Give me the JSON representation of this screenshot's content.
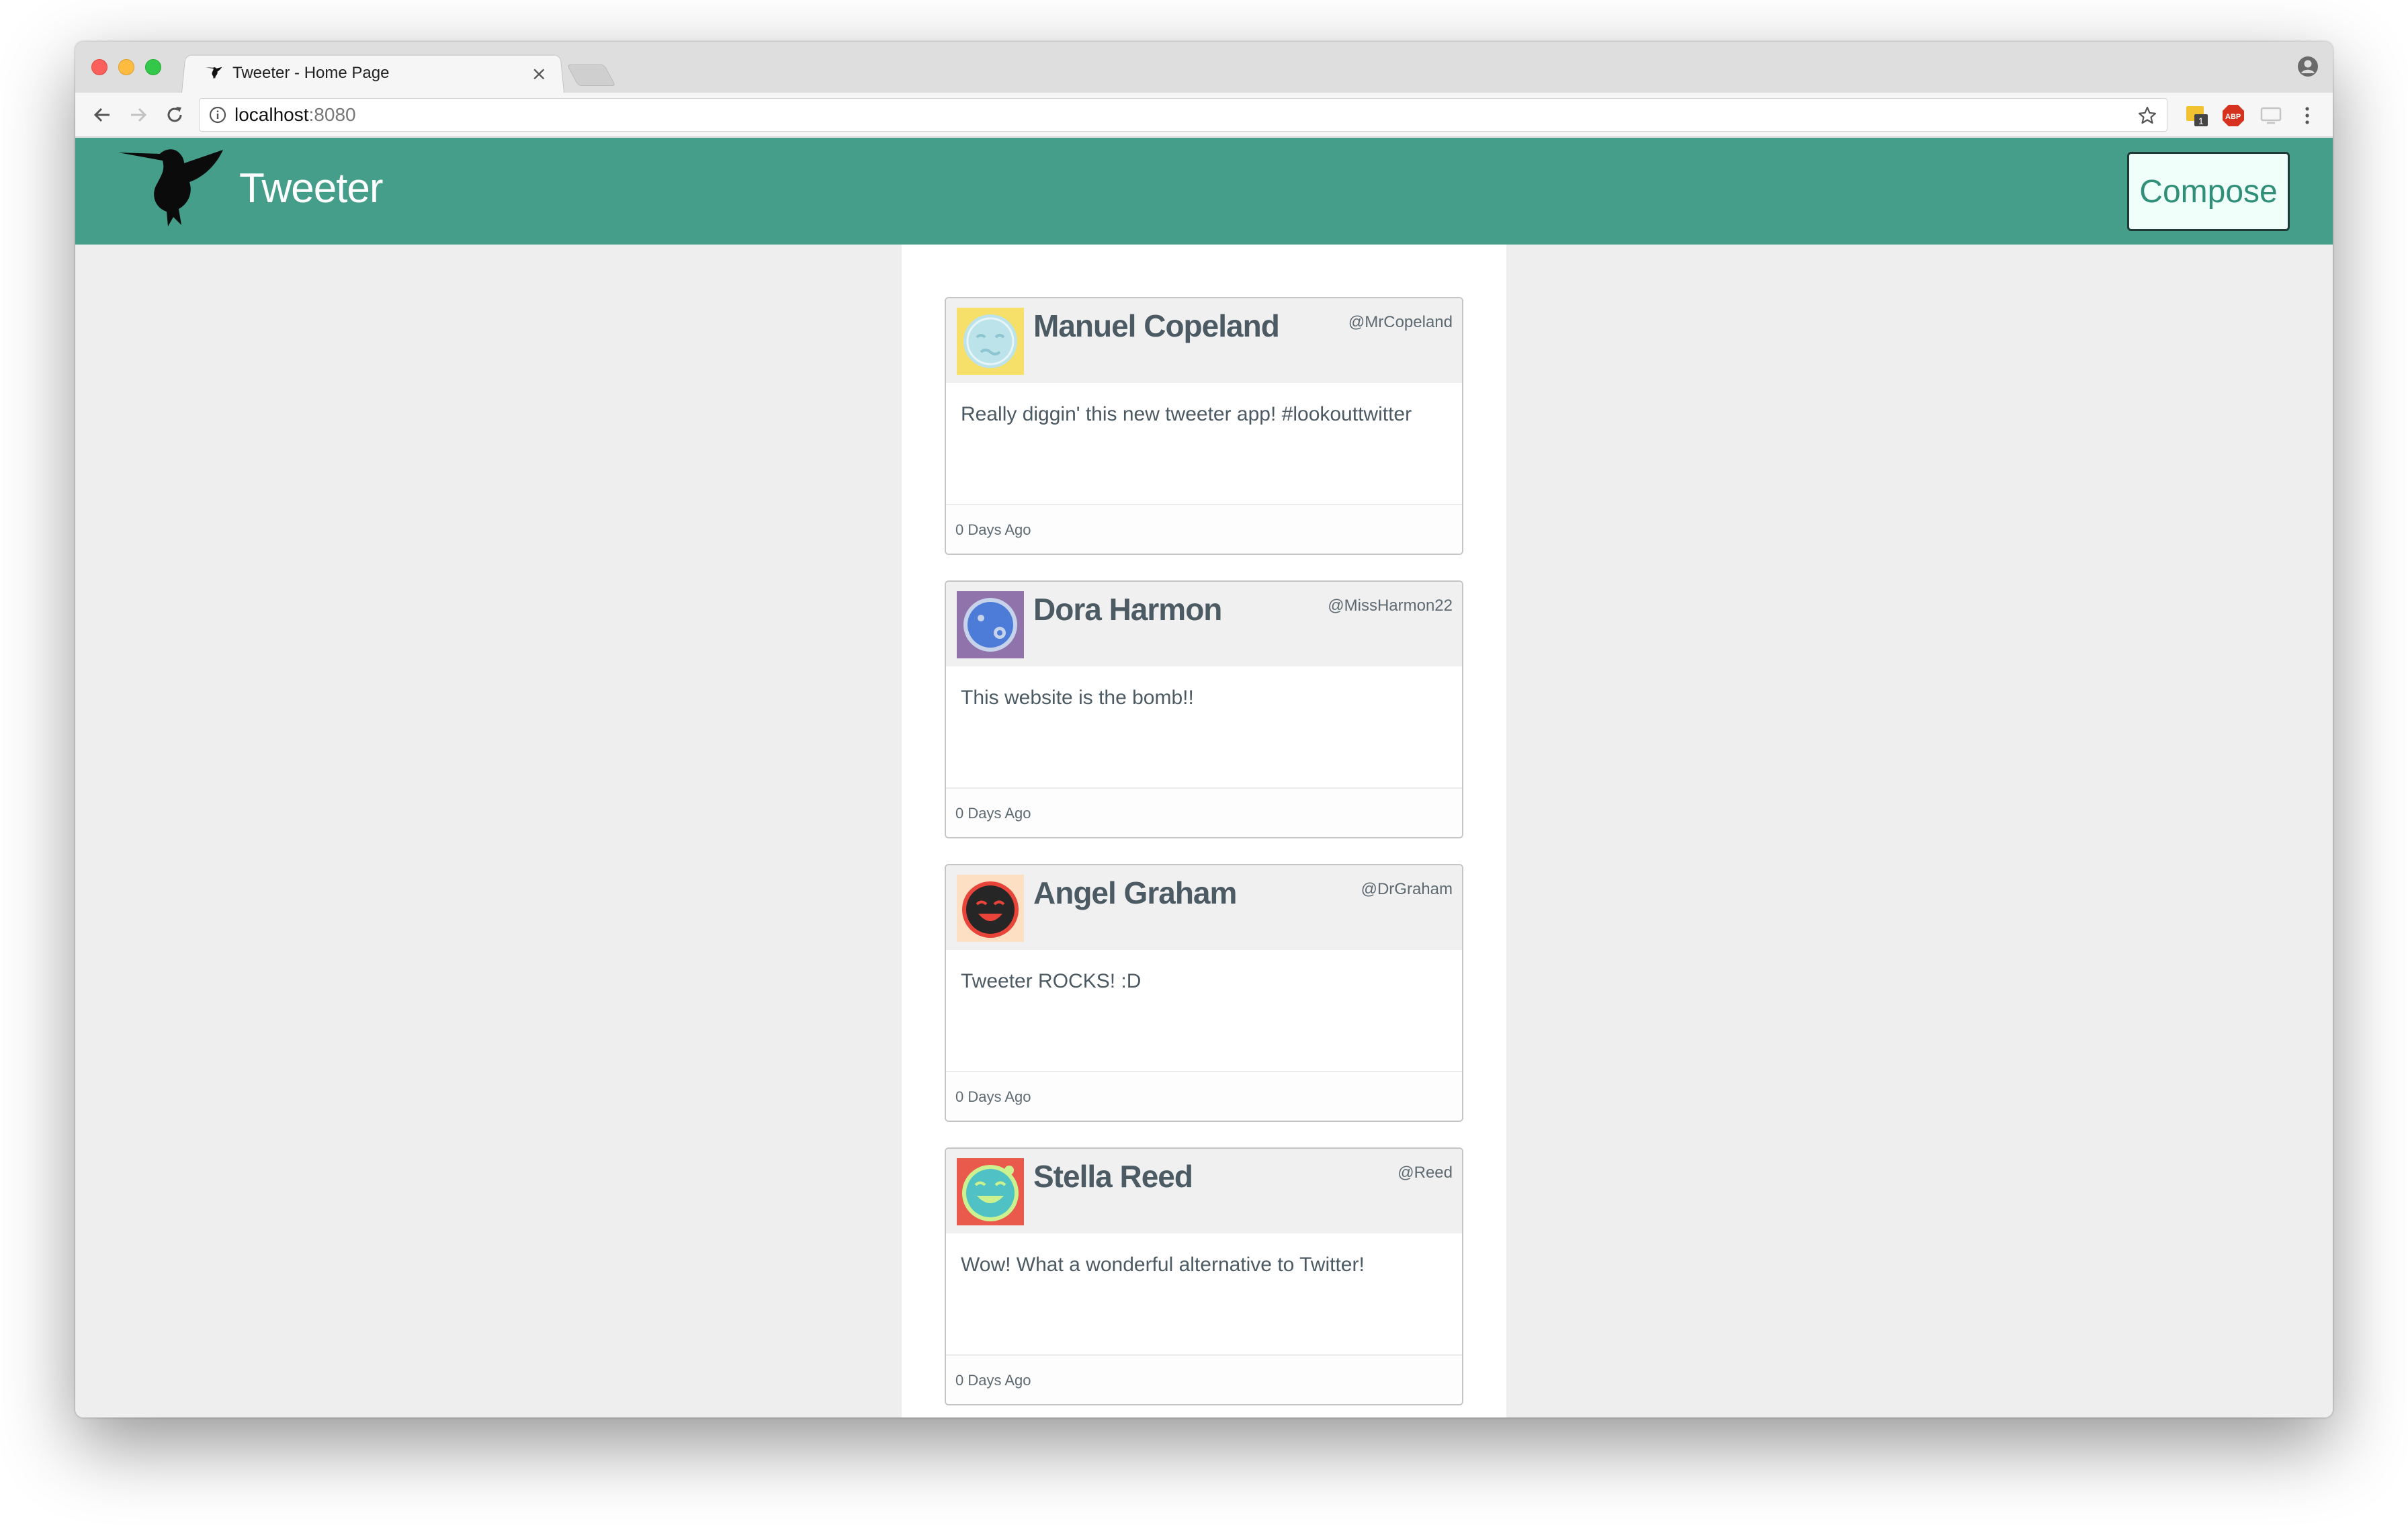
{
  "browser": {
    "tab_title": "Tweeter - Home Page",
    "tab_close": "×",
    "url_host": "localhost",
    "url_port": ":8080",
    "extension_badge": "1",
    "adblock_label": "ABP"
  },
  "header": {
    "brand": "Tweeter",
    "compose_label": "Compose",
    "accent_color": "#449e89"
  },
  "tweets": [
    {
      "name": "Manuel Copeland",
      "handle": "@MrCopeland",
      "body": "Really diggin' this new tweeter app! #lookouttwitter",
      "time": "0 Days Ago",
      "avatar_bg": "#f6e06a",
      "avatar_face": "#bde3ea",
      "avatar_icon": "sleepy-face-icon"
    },
    {
      "name": "Dora Harmon",
      "handle": "@MissHarmon22",
      "body": "This website is the bomb!!",
      "time": "0 Days Ago",
      "avatar_bg": "#9073aa",
      "avatar_face": "#4d7bd8",
      "avatar_icon": "dizzy-face-icon"
    },
    {
      "name": "Angel Graham",
      "handle": "@DrGraham",
      "body": "Tweeter ROCKS! :D",
      "time": "0 Days Ago",
      "avatar_bg": "#fde0c4",
      "avatar_face": "#262626",
      "avatar_icon": "laughing-face-icon"
    },
    {
      "name": "Stella Reed",
      "handle": "@Reed",
      "body": "Wow! What a wonderful alternative to Twitter!",
      "time": "0 Days Ago",
      "avatar_bg": "#ea5a4c",
      "avatar_face": "#b8e97a",
      "avatar_icon": "laughing-tears-face-icon"
    }
  ]
}
